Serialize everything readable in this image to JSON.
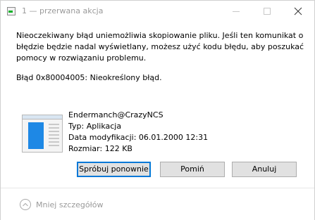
{
  "window": {
    "title": "1 — przerwana akcja",
    "icon": "progress-icon"
  },
  "message": {
    "text": "Nieoczekiwany błąd uniemożliwia skopiowanie pliku. Jeśli ten komunikat o\nbłędzie będzie nadal wyświetlany, możesz użyć kodu błędu, aby poszukać\npomocy w rozwiązaniu problemu.",
    "error": "Błąd 0x80004005: Nieokreślony błąd."
  },
  "file": {
    "name": "Endermanch@CrazyNCS",
    "type": "Typ: Aplikacja",
    "modified": "Data modyfikacji: 06.01.2000 12:31",
    "size": "Rozmiar: 122 KB"
  },
  "buttons": {
    "retry": "Spróbuj ponownie",
    "skip": "Pomiń",
    "cancel": "Anuluj"
  },
  "footer": {
    "less_details": "Mniej szczegółów"
  },
  "colors": {
    "accent": "#0078d7",
    "button_bg": "#e1e1e1",
    "muted_text": "#9a9a9a"
  }
}
